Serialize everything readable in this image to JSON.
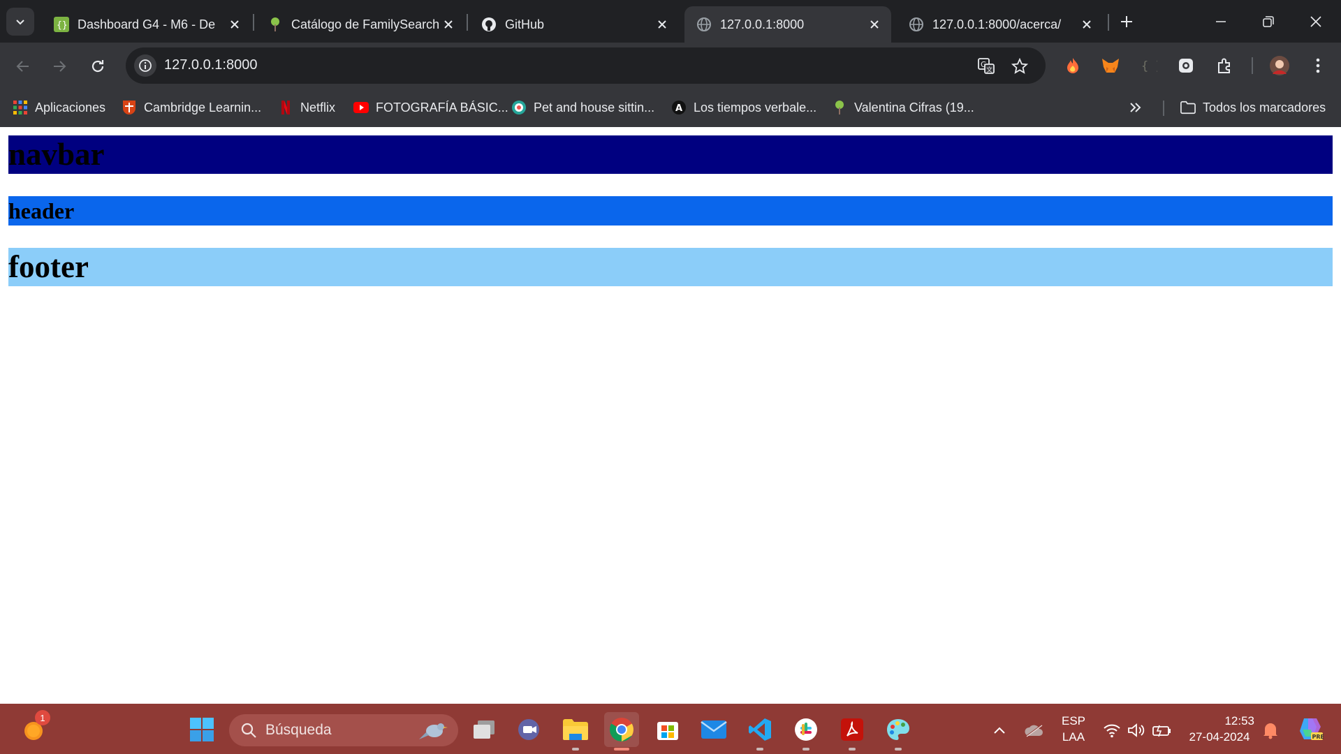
{
  "browser": {
    "tabs": [
      {
        "title": "Dashboard G4 - M6 - De",
        "favicon": "bracket-logo-icon",
        "active": false
      },
      {
        "title": "Catálogo de FamilySearch",
        "favicon": "tree-icon",
        "active": false
      },
      {
        "title": "GitHub",
        "favicon": "github-icon",
        "active": false
      },
      {
        "title": "127.0.0.1:8000",
        "favicon": "globe-icon",
        "active": true
      },
      {
        "title": "127.0.0.1:8000/acerca/",
        "favicon": "globe-icon",
        "active": false
      }
    ],
    "address_bar": {
      "url": "127.0.0.1:8000"
    },
    "bookmarks": [
      {
        "label": "Aplicaciones",
        "icon": "apps-grid-icon"
      },
      {
        "label": "Cambridge Learnin...",
        "icon": "cambridge-icon"
      },
      {
        "label": "Netflix",
        "icon": "netflix-icon"
      },
      {
        "label": "FOTOGRAFÍA BÁSIC...",
        "icon": "youtube-icon"
      },
      {
        "label": "Pet and house sittin...",
        "icon": "pet-site-icon"
      },
      {
        "label": "Los tiempos verbale...",
        "icon": "letter-a-icon"
      },
      {
        "label": "Valentina Cifras (19...",
        "icon": "tree-icon"
      }
    ],
    "all_bookmarks_label": "Todos los marcadores"
  },
  "page": {
    "navbar_text": "navbar",
    "header_text": "header",
    "footer_text": "footer"
  },
  "taskbar": {
    "search_placeholder": "Búsqueda",
    "notification_badge": "1",
    "language_line1": "ESP",
    "language_line2": "LAA",
    "time": "12:53",
    "date": "27-04-2024"
  },
  "colors": {
    "navbar_bg": "#000080",
    "header_bg": "#0a66ec",
    "footer_bg": "#8bcdf9",
    "taskbar_bg": "#8f3a35",
    "chrome_dark": "#202124",
    "chrome_toolbar": "#35363a"
  }
}
